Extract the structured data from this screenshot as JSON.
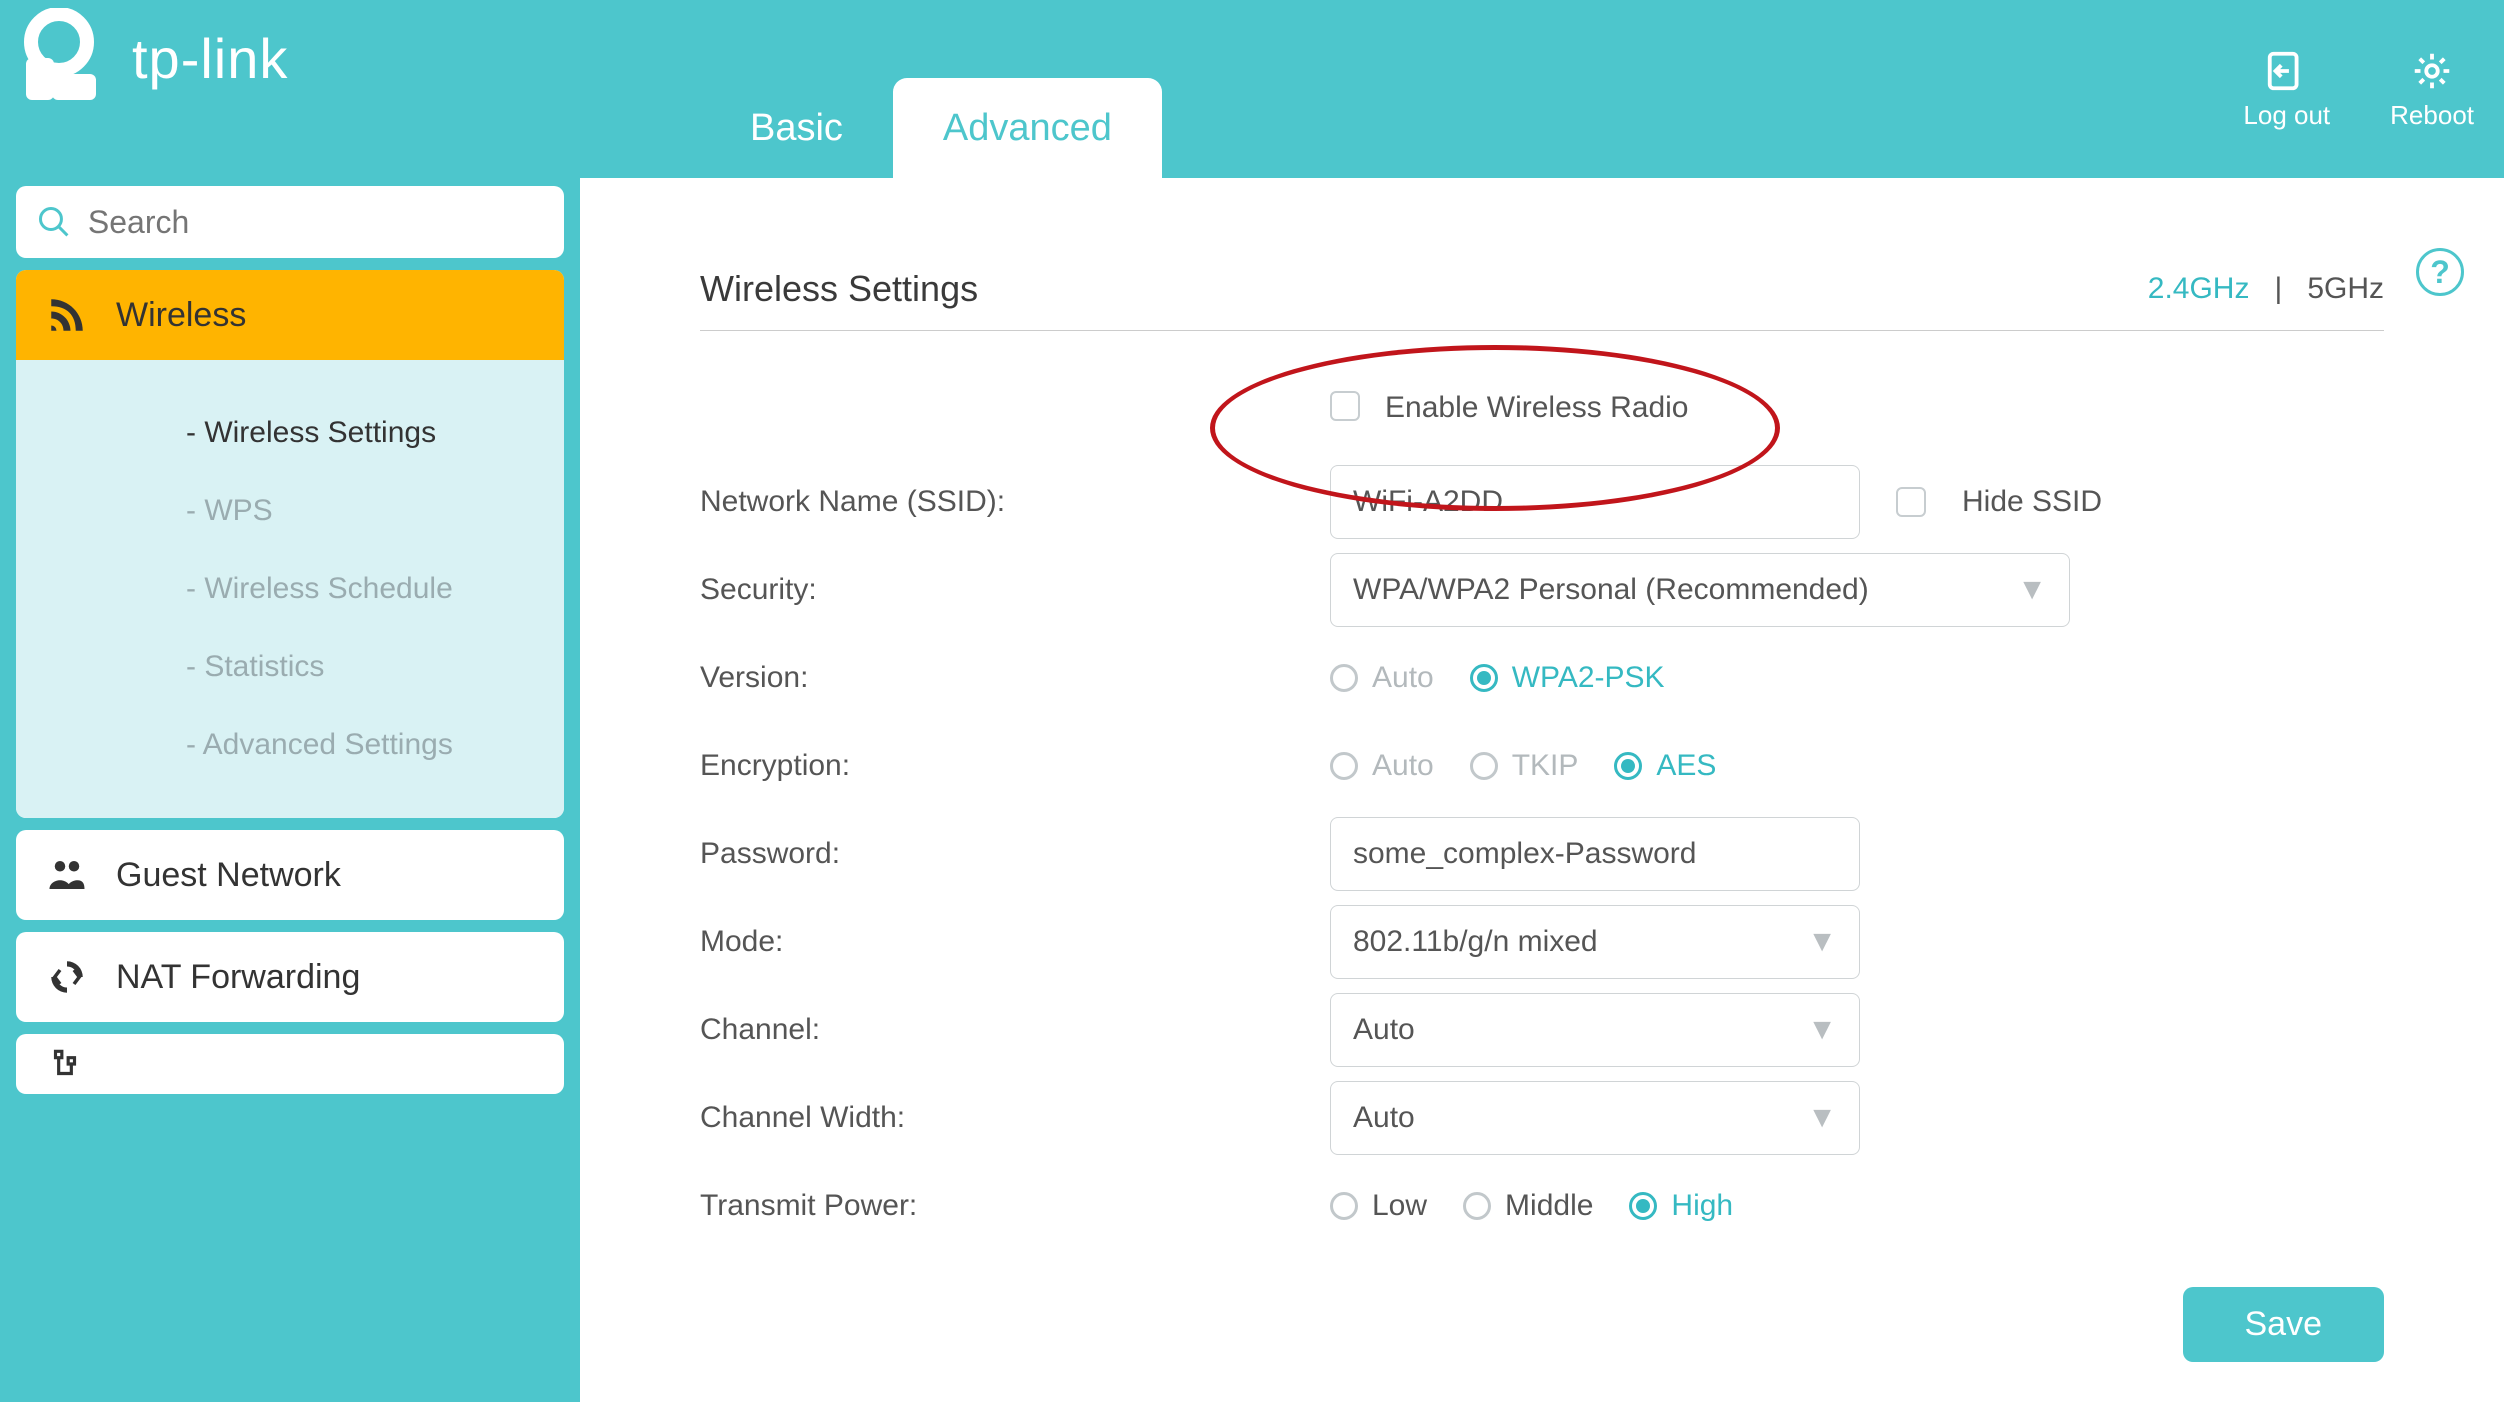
{
  "brand": "tp-link",
  "tabs": {
    "basic": "Basic",
    "advanced": "Advanced",
    "active": "advanced"
  },
  "header_actions": {
    "logout": "Log out",
    "reboot": "Reboot"
  },
  "search": {
    "placeholder": "Search"
  },
  "sidebar": {
    "wireless": {
      "label": "Wireless",
      "children": [
        {
          "label": "- Wireless Settings",
          "active": true
        },
        {
          "label": "- WPS",
          "active": false
        },
        {
          "label": "- Wireless Schedule",
          "active": false
        },
        {
          "label": "- Statistics",
          "active": false
        },
        {
          "label": "- Advanced Settings",
          "active": false
        }
      ]
    },
    "guest": {
      "label": "Guest Network"
    },
    "nat": {
      "label": "NAT Forwarding"
    }
  },
  "panel": {
    "title": "Wireless Settings",
    "band": {
      "b24": "2.4GHz",
      "sep": "|",
      "b5": "5GHz",
      "active": "2.4"
    },
    "enable_radio": {
      "label": "Enable Wireless Radio",
      "checked": false
    },
    "ssid": {
      "label": "Network Name (SSID):",
      "value": "WiFi-A2DD",
      "hide_label": "Hide SSID",
      "hide_checked": false
    },
    "security": {
      "label": "Security:",
      "value": "WPA/WPA2 Personal (Recommended)"
    },
    "version": {
      "label": "Version:",
      "options": {
        "auto": "Auto",
        "wpa2psk": "WPA2-PSK"
      },
      "selected": "wpa2psk"
    },
    "encryption": {
      "label": "Encryption:",
      "options": {
        "auto": "Auto",
        "tkip": "TKIP",
        "aes": "AES"
      },
      "selected": "aes"
    },
    "password": {
      "label": "Password:",
      "value": "some_complex-Password"
    },
    "mode": {
      "label": "Mode:",
      "value": "802.11b/g/n mixed"
    },
    "channel": {
      "label": "Channel:",
      "value": "Auto"
    },
    "channel_width": {
      "label": "Channel Width:",
      "value": "Auto"
    },
    "transmit_power": {
      "label": "Transmit Power:",
      "options": {
        "low": "Low",
        "middle": "Middle",
        "high": "High"
      },
      "selected": "high"
    },
    "save": "Save",
    "help": "?"
  }
}
